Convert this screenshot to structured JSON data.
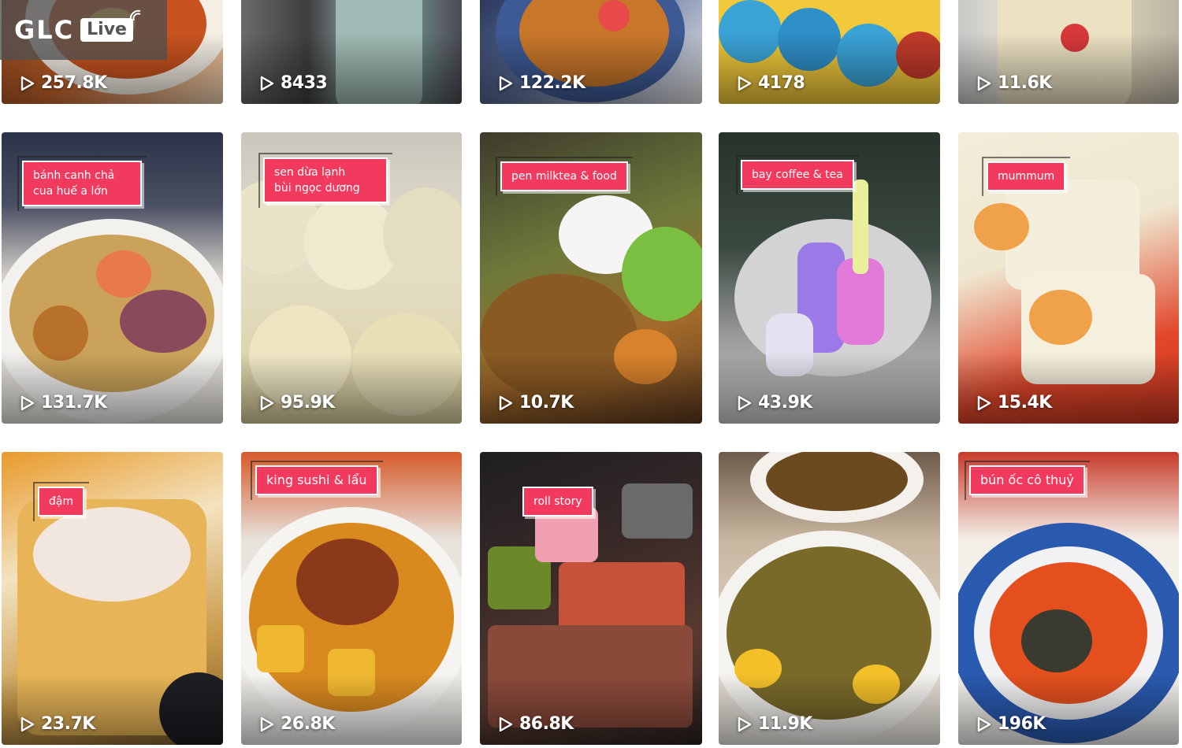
{
  "logo": {
    "brand": "GLC",
    "badge": "Live",
    "icon": "live-signal-icon"
  },
  "play_icon": "play-icon",
  "colors": {
    "tag_background": "#f23a5e",
    "tag_text": "#ffffff",
    "view_text": "#ffffff"
  },
  "videos": [
    {
      "views": "257.8K",
      "tag": ""
    },
    {
      "views": "8433",
      "tag": ""
    },
    {
      "views": "122.2K",
      "tag": ""
    },
    {
      "views": "4178",
      "tag": ""
    },
    {
      "views": "11.6K",
      "tag": ""
    },
    {
      "views": "131.7K",
      "tag": "bánh canh chả\ncua huế a lớn"
    },
    {
      "views": "95.9K",
      "tag": "sen dừa lạnh\nbùi ngọc dương"
    },
    {
      "views": "10.7K",
      "tag": "pen milktea & food"
    },
    {
      "views": "43.9K",
      "tag": "bay coffee & tea"
    },
    {
      "views": "15.4K",
      "tag": "mummum"
    },
    {
      "views": "23.7K",
      "tag": "đậm"
    },
    {
      "views": "26.8K",
      "tag": "king sushi & lẩu"
    },
    {
      "views": "86.8K",
      "tag": "roll story"
    },
    {
      "views": "11.9K",
      "tag": ""
    },
    {
      "views": "196K",
      "tag": "bún ốc cô thuỷ"
    }
  ]
}
